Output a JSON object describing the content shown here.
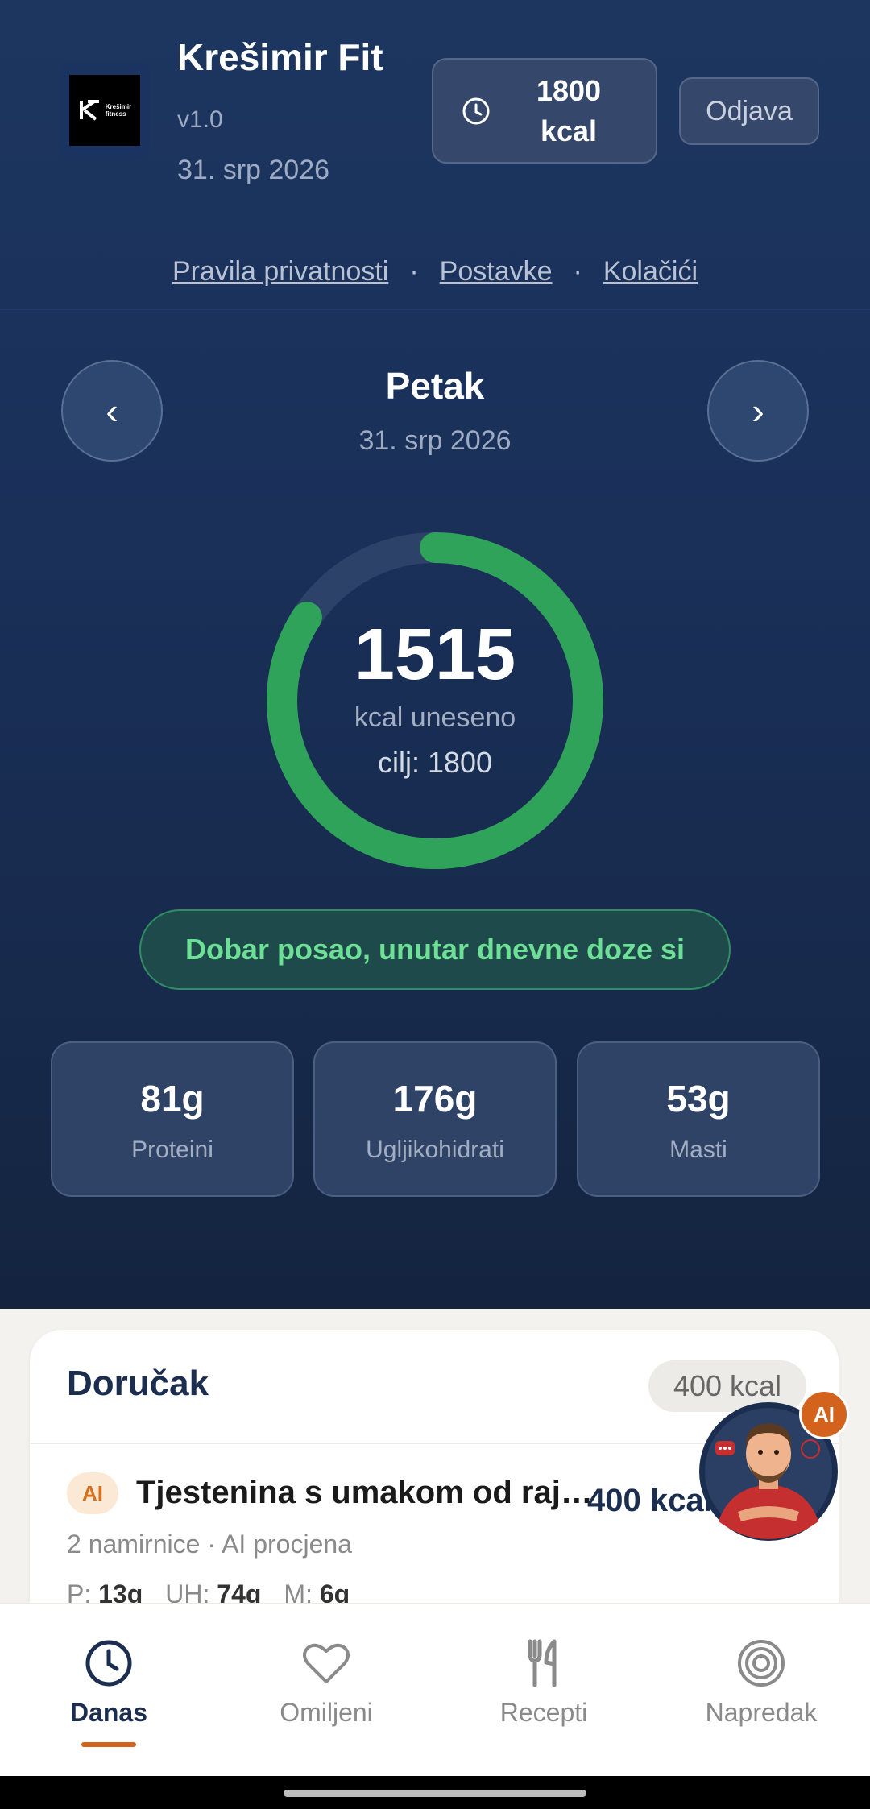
{
  "header": {
    "logo_text_line1": "Krešimir",
    "logo_text_line2": "fitness",
    "title": "Krešimir Fit",
    "version": "v1.0",
    "date": "31. srp 2026",
    "kcal_target_line1": "1800",
    "kcal_target_line2": "kcal",
    "logout_label": "Odjava"
  },
  "links": {
    "privacy": "Pravila privatnosti",
    "settings": "Postavke",
    "cookies": "Kolačići",
    "separator": "·"
  },
  "day": {
    "prev_label": "‹",
    "next_label": "›",
    "name": "Petak",
    "date": "31. srp 2026"
  },
  "summary": {
    "consumed": "1515",
    "consumed_label": "kcal uneseno",
    "goal_label": "cilj: 1800",
    "progress_fraction": 0.8417,
    "status_message": "Dobar posao, unutar dnevne doze si"
  },
  "macros": [
    {
      "value": "81g",
      "label": "Proteini"
    },
    {
      "value": "176g",
      "label": "Ugljikohidrati"
    },
    {
      "value": "53g",
      "label": "Masti"
    }
  ],
  "meal": {
    "title": "Doručak",
    "kcal": "400 kcal",
    "item": {
      "badge": "AI",
      "name": "Tjestenina s umakom od raj…",
      "kcal": "400 kcal",
      "subtitle": "2 namirnice · AI procjena",
      "p_label": "P:",
      "p_value": "13g",
      "uh_label": "UH:",
      "uh_value": "74g",
      "m_label": "M:",
      "m_value": "6g"
    }
  },
  "assistant": {
    "badge": "AI"
  },
  "bottom_nav": [
    {
      "label": "Danas",
      "icon": "clock-icon",
      "active": true
    },
    {
      "label": "Omiljeni",
      "icon": "heart-icon",
      "active": false
    },
    {
      "label": "Recepti",
      "icon": "cutlery-icon",
      "active": false
    },
    {
      "label": "Napredak",
      "icon": "target-icon",
      "active": false
    }
  ],
  "colors": {
    "accent_green": "#2fa35a",
    "accent_orange": "#d3631c",
    "navy": "#1b2e4f"
  }
}
